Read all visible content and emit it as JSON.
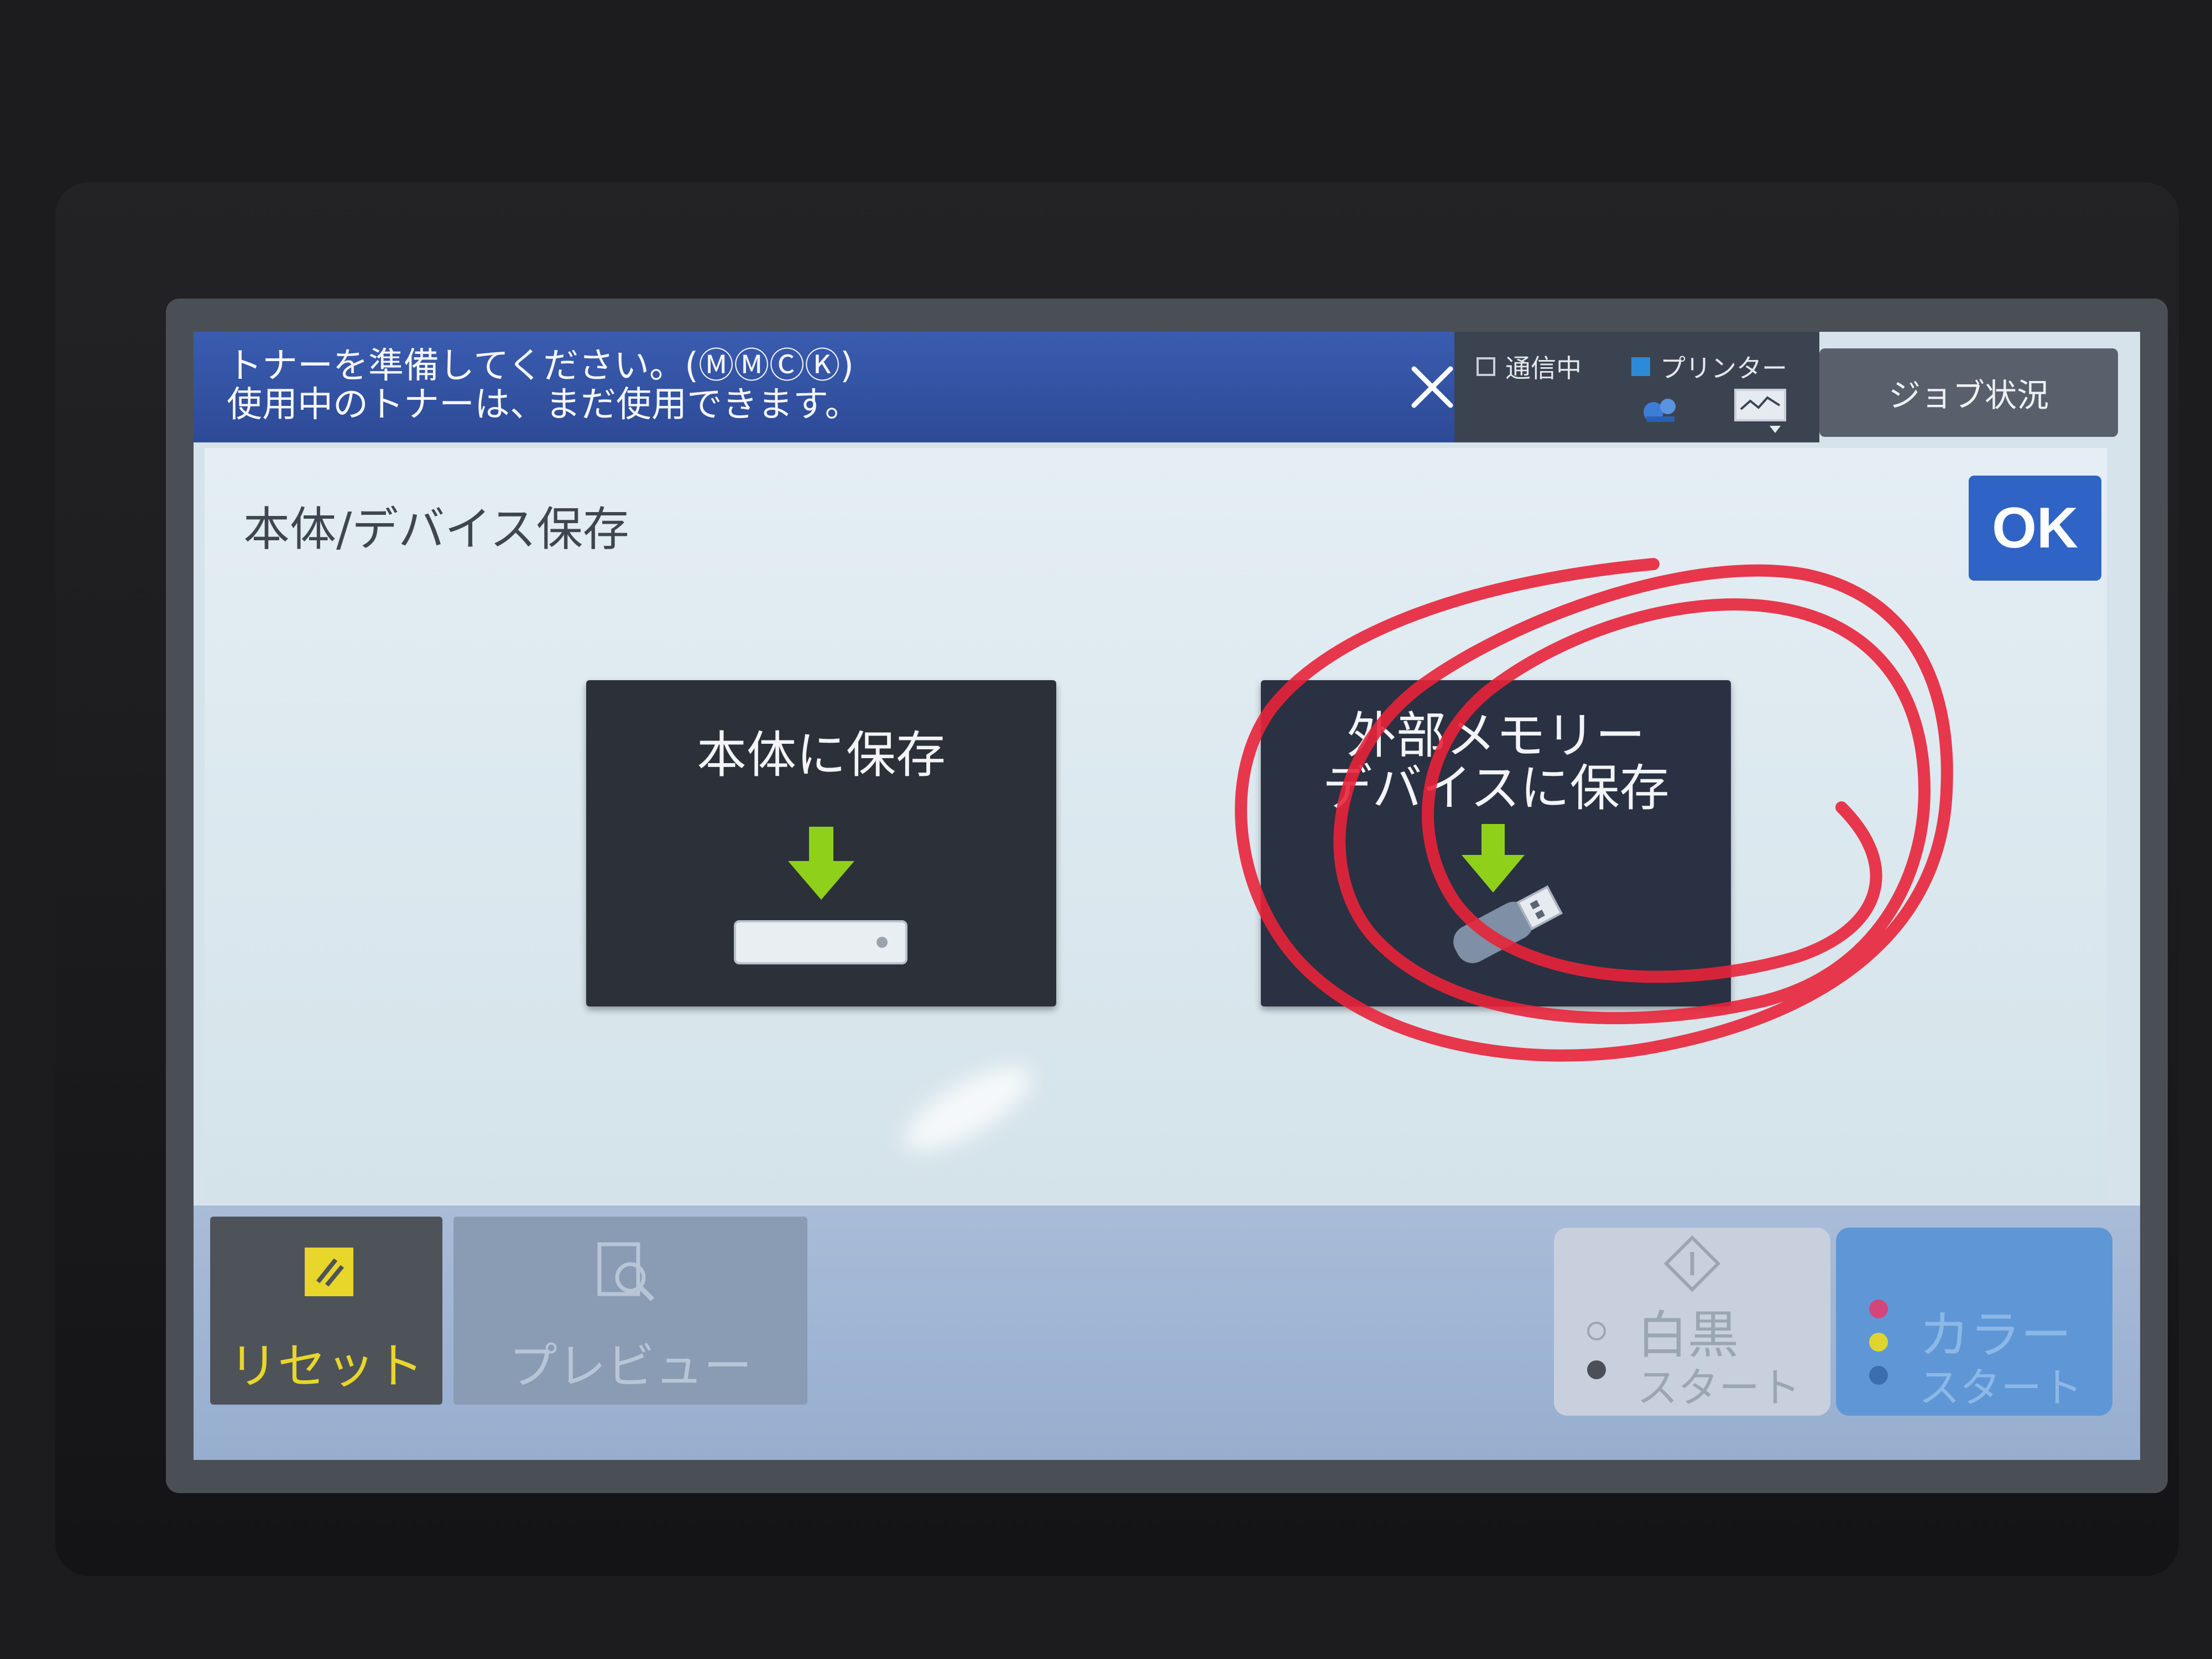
{
  "notification": {
    "line1": "トナーを準備してください。(ⓂⓂⒸⓀ)",
    "line2": "使用中のトナーは、まだ使用できます。"
  },
  "status": {
    "communicating": "通信中",
    "printer": "プリンター",
    "job_status_label": "ジョブ状況"
  },
  "panel": {
    "title": "本体/デバイス保存",
    "ok_label": "OK",
    "save_internal_label": "本体に保存",
    "save_external_line1": "外部メモリー",
    "save_external_line2": "デバイスに保存"
  },
  "bottom": {
    "reset_label": "リセット",
    "preview_label": "プレビュー",
    "bw_main": "白黒",
    "bw_sub": "スタート",
    "color_main": "カラー",
    "color_sub": "スタート"
  },
  "colors": {
    "notification_bar": "#2d4a96",
    "ok_button": "#2f63c5",
    "tile_background": "#2c3038",
    "arrow_green": "#8fd11a",
    "reset_yellow": "#e8d62a",
    "annotation_red": "#e8243a",
    "color_start": "#5f97d6"
  },
  "icons": {
    "close": "close-icon",
    "printer_status": "printer-status-icon",
    "network_status": "network-status-icon",
    "download_arrow": "download-arrow-icon",
    "internal_storage": "hard-drive-icon",
    "usb": "usb-drive-icon",
    "reset": "reset-icon",
    "preview": "preview-icon",
    "start": "start-diamond-icon"
  }
}
